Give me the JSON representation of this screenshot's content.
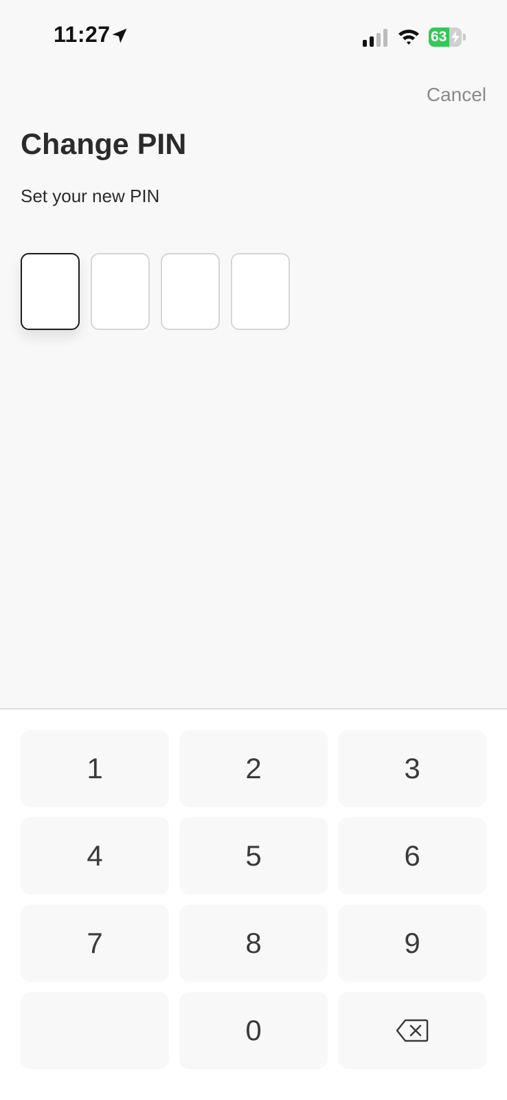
{
  "status_bar": {
    "time": "11:27",
    "battery_level": "63",
    "battery_fraction": 0.63,
    "icons": [
      "location-arrow-icon",
      "cellular-signal-icon",
      "wifi-icon",
      "battery-charging-icon"
    ]
  },
  "header": {
    "cancel_label": "Cancel",
    "title": "Change PIN",
    "subtitle": "Set your new PIN"
  },
  "pin": {
    "length": 4,
    "filled": 0,
    "active_index": 0
  },
  "keypad": {
    "keys": [
      "1",
      "2",
      "3",
      "4",
      "5",
      "6",
      "7",
      "8",
      "9",
      "",
      "0",
      "backspace"
    ],
    "backspace_icon": "backspace-icon"
  },
  "colors": {
    "background": "#f8f8f8",
    "keypad_background": "#ffffff",
    "key_background": "#f8f8f8",
    "text": "#2b2b2b",
    "cancel": "#8a8a8a",
    "battery_green": "#34c759"
  }
}
